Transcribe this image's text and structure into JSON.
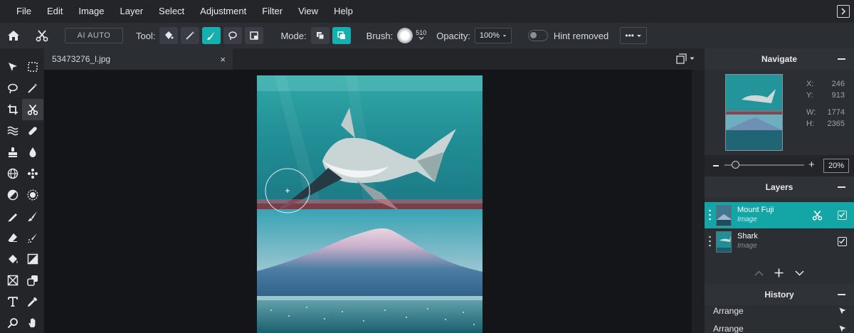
{
  "menu": [
    "File",
    "Edit",
    "Image",
    "Layer",
    "Select",
    "Adjustment",
    "Filter",
    "View",
    "Help"
  ],
  "toolbar": {
    "ai_auto": "AI AUTO",
    "tool_label": "Tool:",
    "mode_label": "Mode:",
    "brush_label": "Brush:",
    "brush_size": "510",
    "opacity_label": "Opacity:",
    "opacity_value": "100%",
    "hint_label": "Hint removed",
    "more": "•••"
  },
  "document": {
    "tab_name": "53473276_l.jpg",
    "close": "×"
  },
  "navigate": {
    "title": "Navigate",
    "x_label": "X:",
    "x_value": "246",
    "y_label": "Y:",
    "y_value": "913",
    "w_label": "W:",
    "w_value": "1774",
    "h_label": "H:",
    "h_value": "2365",
    "zoom_value": "20%",
    "zoom_level": 0.1
  },
  "layers": {
    "title": "Layers",
    "items": [
      {
        "name": "Mount Fuji",
        "type": "Image"
      },
      {
        "name": "Shark",
        "type": "Image"
      }
    ]
  },
  "history": {
    "title": "History",
    "items": [
      "Arrange",
      "Arrange"
    ]
  },
  "colors": {
    "accent": "#14b0b0",
    "panel": "#2b2e33",
    "menubar": "#232529"
  }
}
